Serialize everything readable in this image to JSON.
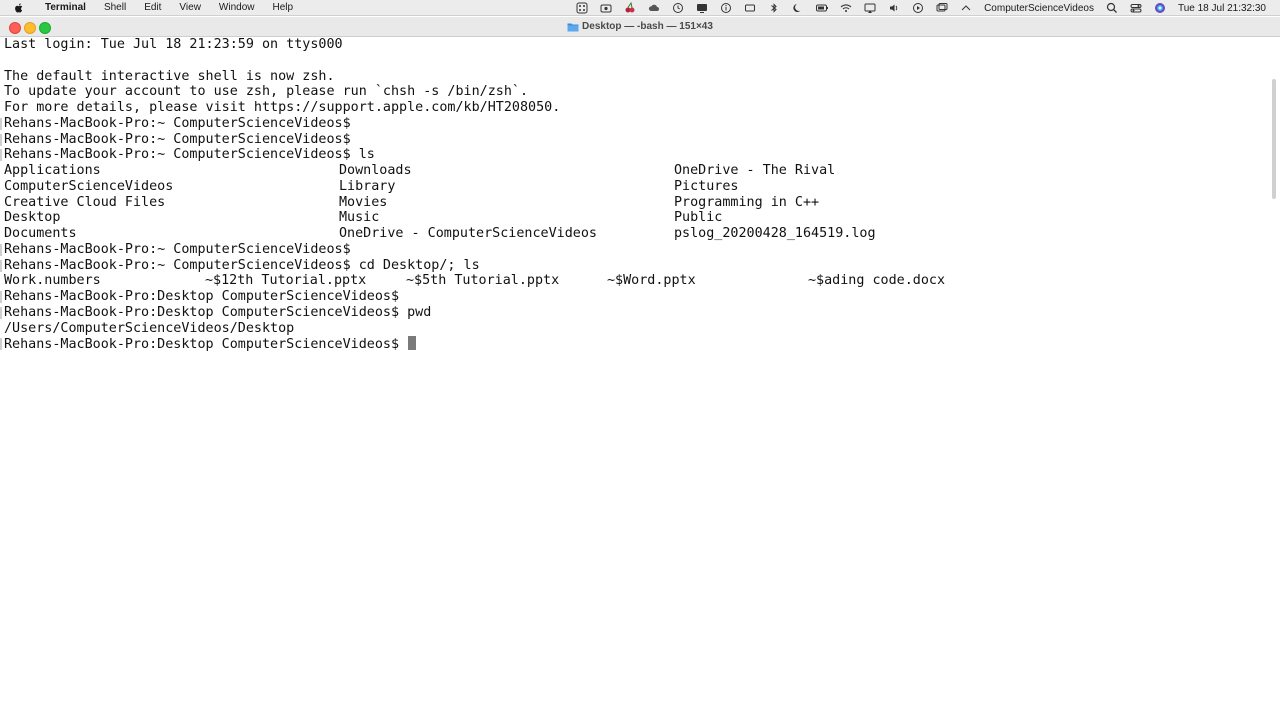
{
  "menubar": {
    "app_name": "Terminal",
    "menus": [
      "Shell",
      "Edit",
      "View",
      "Window",
      "Help"
    ],
    "user": "ComputerScienceVideos",
    "clock": "Tue 18 Jul  21:32:30"
  },
  "window": {
    "title": "Desktop — -bash — 151×43"
  },
  "terminal": {
    "lines": [
      {
        "text": "Last login: Tue Jul 18 21:23:59 on ttys000"
      },
      {
        "text": ""
      },
      {
        "text": "The default interactive shell is now zsh."
      },
      {
        "text": "To update your account to use zsh, please run `chsh -s /bin/zsh`."
      },
      {
        "text": "For more details, please visit https://support.apple.com/kb/HT208050."
      },
      {
        "text": "Rehans-MacBook-Pro:~ ComputerScienceVideos$",
        "prompt": true
      },
      {
        "text": "Rehans-MacBook-Pro:~ ComputerScienceVideos$",
        "prompt": true
      },
      {
        "text": "Rehans-MacBook-Pro:~ ComputerScienceVideos$ ls",
        "prompt": true
      },
      {
        "cols": [
          "Applications",
          "Downloads",
          "OneDrive - The Rival"
        ]
      },
      {
        "cols": [
          "ComputerScienceVideos",
          "Library",
          "Pictures"
        ]
      },
      {
        "cols": [
          "Creative Cloud Files",
          "Movies",
          "Programming in C++"
        ]
      },
      {
        "cols": [
          "Desktop",
          "Music",
          "Public"
        ]
      },
      {
        "cols": [
          "Documents",
          "OneDrive - ComputerScienceVideos",
          "pslog_20200428_164519.log"
        ]
      },
      {
        "text": "Rehans-MacBook-Pro:~ ComputerScienceVideos$",
        "prompt": true
      },
      {
        "text": "Rehans-MacBook-Pro:~ ComputerScienceVideos$ cd Desktop/; ls",
        "prompt": true
      },
      {
        "cols5": [
          "Work.numbers",
          "~$12th Tutorial.pptx",
          "~$5th Tutorial.pptx",
          "~$Word.pptx",
          "~$ading code.docx"
        ]
      },
      {
        "text": "Rehans-MacBook-Pro:Desktop ComputerScienceVideos$",
        "prompt": true
      },
      {
        "text": "Rehans-MacBook-Pro:Desktop ComputerScienceVideos$ pwd",
        "prompt": true
      },
      {
        "text": "/Users/ComputerScienceVideos/Desktop"
      },
      {
        "text": "Rehans-MacBook-Pro:Desktop ComputerScienceVideos$ ",
        "prompt": true,
        "cursor": true
      }
    ]
  }
}
